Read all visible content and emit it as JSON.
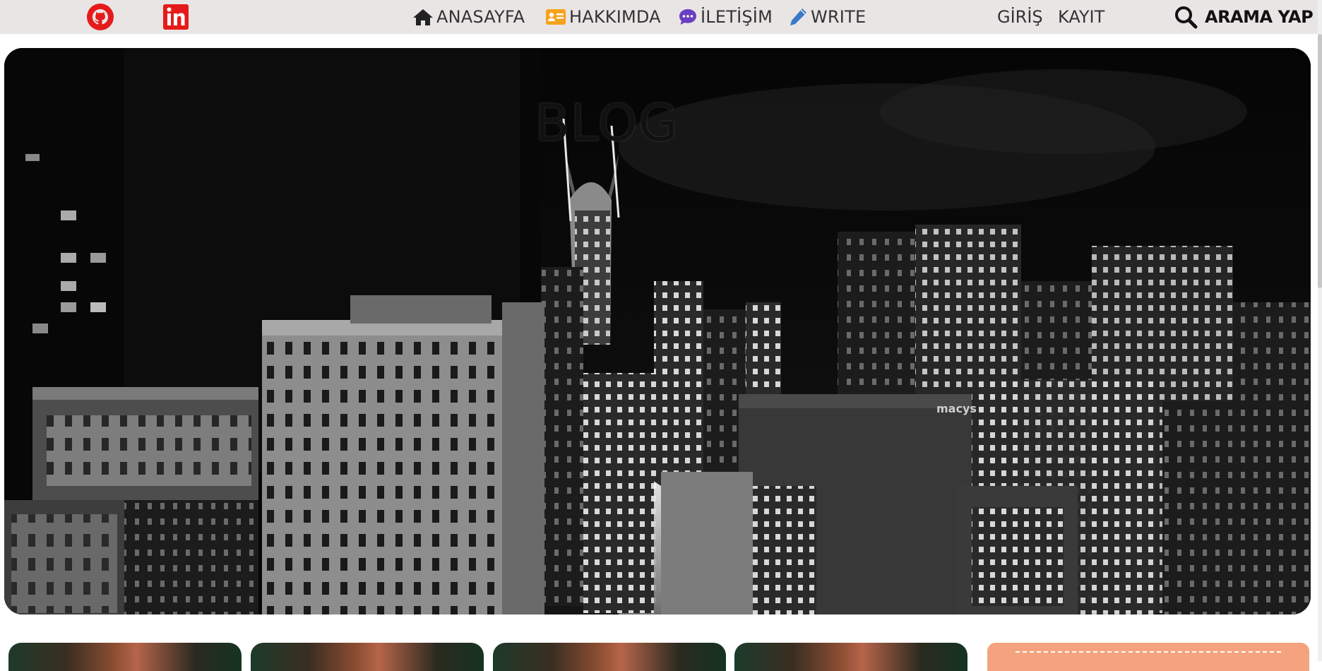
{
  "social": {
    "github": "github-icon",
    "linkedin": "linkedin-icon",
    "brand_color": "#e51b1b"
  },
  "nav": {
    "items": [
      {
        "label": "ANASAYFA",
        "icon": "home-icon"
      },
      {
        "label": "HAKKIMDA",
        "icon": "id-card-icon"
      },
      {
        "label": "İLETİŞİM",
        "icon": "chat-icon"
      },
      {
        "label": "WRITE",
        "icon": "pen-icon"
      }
    ]
  },
  "auth": {
    "login": "GİRİŞ",
    "register": "KAYIT"
  },
  "search": {
    "label": "ARAMA YAP",
    "icon": "search-icon"
  },
  "hero": {
    "title": "BLOG",
    "sign_text": "macys"
  },
  "colors": {
    "topbar": "#e9e5e5",
    "accent_orange": "#f4a37e",
    "about_icon": "#f7a21b",
    "contact_icon": "#6a3fc2",
    "write_icon": "#3a78c9"
  }
}
